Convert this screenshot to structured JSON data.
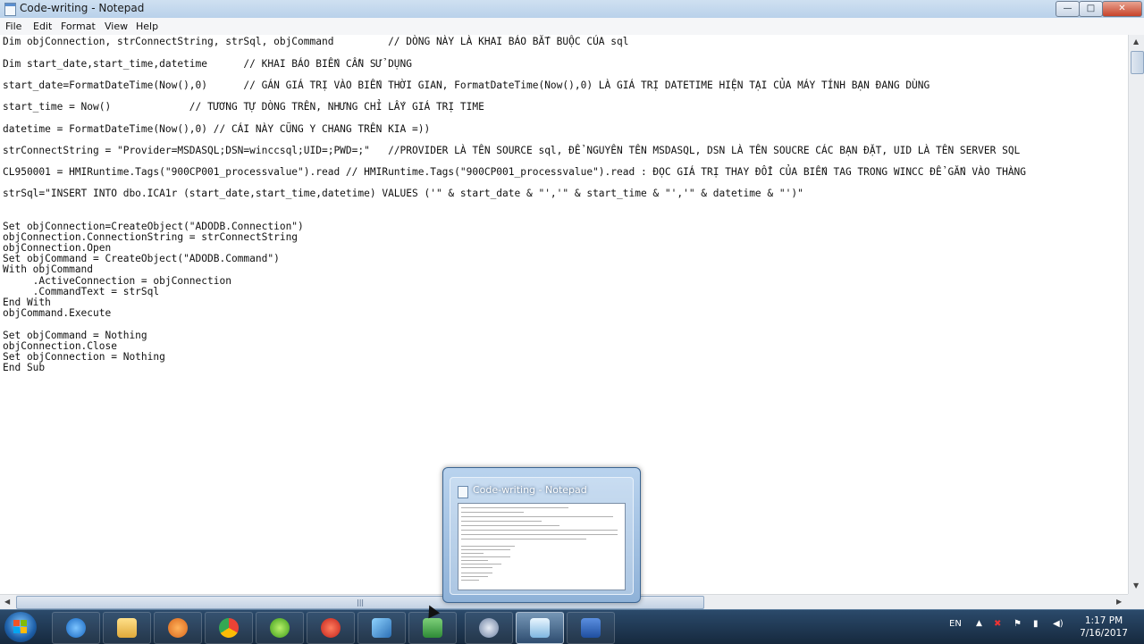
{
  "window": {
    "title": "Code-writing - Notepad",
    "minimize_glyph": "—",
    "maximize_glyph": "□",
    "close_glyph": "✕"
  },
  "menu": [
    "File",
    "Edit",
    "Format",
    "View",
    "Help"
  ],
  "code_lines": [
    "Dim objConnection, strConnectString, strSql, objCommand         // DÒNG NÀY LÀ KHAI BÁO BẮT BUỘC CỦA sql",
    "Dim start_date,start_time,datetime      // KHAI BÁO BIẾN CẦN SỬ DỤNG",
    "start_date=FormatDateTime(Now(),0)      // GÁN GIÁ TRỊ VÀO BIẾN THỜI GIAN, FormatDateTime(Now(),0) LÀ GIÁ TRỊ DATETIME HIỆN TẠI CỦA MÁY TÍNH BẠN ĐANG DÙNG",
    "start_time = Now()             // TƯƠNG TỰ DÒNG TRÊN, NHƯNG CHỈ LẤY GIÁ TRỊ TIME",
    "datetime = FormatDateTime(Now(),0) // CÁI NÀY CŨNG Y CHANG TRÊN KIA =))",
    "strConnectString = \"Provider=MSDASQL;DSN=winccsql;UID=;PWD=;\"   //PROVIDER LÀ TÊN SOURCE sql, ĐỂ NGUYÊN TÊN MSDASQL, DSN LÀ TÊN SOUCRE CÁC BẠN ĐẶT, UID LÀ TÊN SERVER SQL",
    "CL950001 = HMIRuntime.Tags(\"900CP001_processvalue\").read // HMIRuntime.Tags(\"900CP001_processvalue\").read : ĐỌC GIÁ TRỊ THAY ĐỔI CỦA BIẾN TAG TRONG WINCC ĐỂ GẮN VÀO THÀNG",
    "strSql=\"INSERT INTO dbo.ICA1r (start_date,start_time,datetime) VALUES ('\" & start_date & \"','\" & start_time & \"','\" & datetime & \"')\"",
    "Set objConnection=CreateObject(\"ADODB.Connection\")",
    "objConnection.ConnectionString = strConnectString",
    "objConnection.Open",
    "Set objCommand = CreateObject(\"ADODB.Command\")",
    "With objCommand",
    "     .ActiveConnection = objConnection",
    "     .CommandText = strSql",
    "End With",
    "objCommand.Execute",
    "Set objCommand = Nothing",
    "objConnection.Close",
    "Set objConnection = Nothing",
    "End Sub"
  ],
  "taskbar": {
    "items": [
      "start",
      "internet-explorer",
      "file-explorer",
      "media-player",
      "chrome",
      "app-green",
      "ccleaner",
      "app-blue",
      "app-excel",
      "app-gauge",
      "notepad",
      "word"
    ],
    "language": "EN",
    "time": "1:17 PM",
    "date": "7/16/2017"
  },
  "preview": {
    "title": "Code-writing - Notepad"
  },
  "colors": {
    "taskbar": "#1f3a58",
    "titlebar": "#c4d9ee",
    "editor_bg": "#ffffff"
  }
}
